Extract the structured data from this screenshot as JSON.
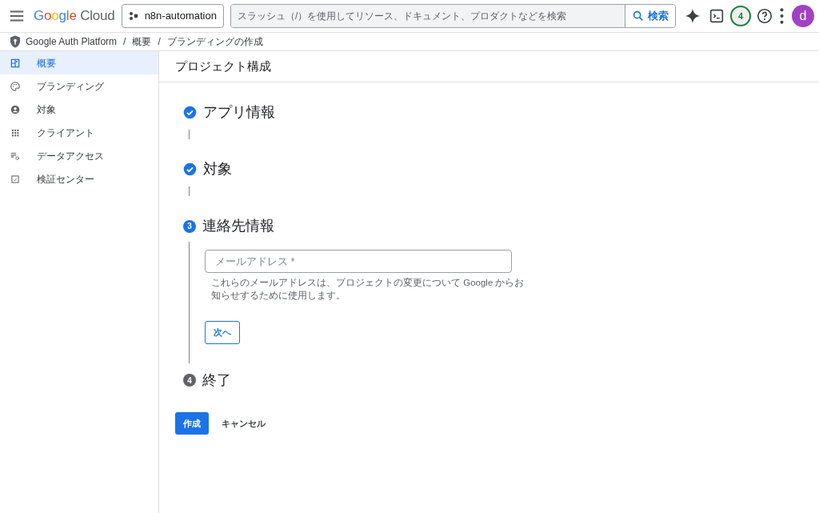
{
  "header": {
    "logo": {
      "brand": "Google",
      "product": "Cloud"
    },
    "project": "n8n-automation",
    "search": {
      "placeholder": "スラッシュ（/）を使用してリソース、ドキュメント、プロダクトなどを検索",
      "button": "検索"
    },
    "notifications": "4",
    "avatar": "d"
  },
  "breadcrumb": {
    "items": [
      "Google Auth Platform",
      "概要",
      "ブランディングの作成"
    ],
    "separators": [
      "/",
      "/"
    ]
  },
  "sidebar": {
    "items": [
      {
        "label": "概要",
        "selected": true
      },
      {
        "label": "ブランディング",
        "selected": false
      },
      {
        "label": "対象",
        "selected": false
      },
      {
        "label": "クライアント",
        "selected": false
      },
      {
        "label": "データアクセス",
        "selected": false
      },
      {
        "label": "検証センター",
        "selected": false
      }
    ]
  },
  "page_title": "プロジェクト構成",
  "steps": [
    {
      "title": "アプリ情報",
      "kind": "done"
    },
    {
      "title": "対象",
      "kind": "done"
    },
    {
      "title": "連絡先情報",
      "kind": "active",
      "number": "3",
      "field": {
        "placeholder": "メールアドレス *"
      },
      "hint": "これらのメールアドレスは、プロジェクトの変更について Google からお知らせするために使用します。",
      "next": "次へ"
    },
    {
      "title": "終了",
      "kind": "todo",
      "number": "4"
    }
  ],
  "actions": {
    "create": "作成",
    "cancel": "キャンセル"
  }
}
